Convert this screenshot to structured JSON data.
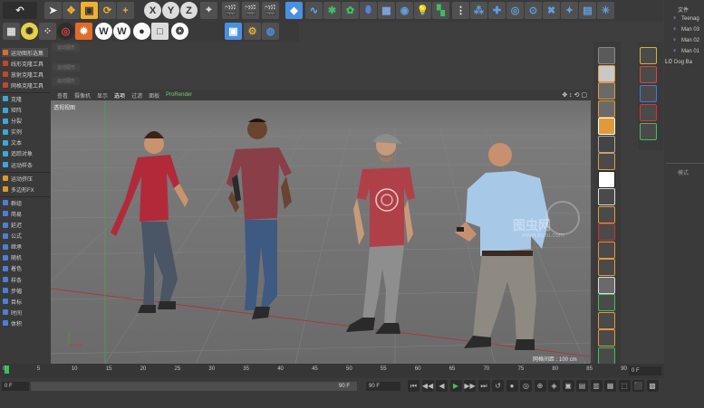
{
  "toolbar": {
    "undo_label": "↶",
    "axis_x": "X",
    "axis_y": "Y",
    "axis_z": "Z"
  },
  "left_panel": {
    "row2_letters": [
      "W",
      "W"
    ],
    "ghost_buttons": [
      "运动图形",
      "运动图形",
      "运动图形"
    ],
    "tools": [
      {
        "label": "运动图形选集",
        "color": "#e06c2b"
      },
      {
        "label": "线形克隆工具",
        "color": "#c4462e"
      },
      {
        "label": "放射克隆工具",
        "color": "#c4462e"
      },
      {
        "label": "网格克隆工具",
        "color": "#c4462e"
      },
      {
        "label": "克隆",
        "color": "#3aa8d8"
      },
      {
        "label": "矩阵",
        "color": "#3aa8d8"
      },
      {
        "label": "分裂",
        "color": "#3aa8d8"
      },
      {
        "label": "实例",
        "color": "#3aa8d8"
      },
      {
        "label": "文本",
        "color": "#3aa8d8"
      },
      {
        "label": "追踪对象",
        "color": "#3aa8d8"
      },
      {
        "label": "运动样条",
        "color": "#3aa8d8"
      },
      {
        "label": "运动挤压",
        "color": "#d99a2b"
      },
      {
        "label": "多边形FX",
        "color": "#d99a2b"
      },
      {
        "label": "群组",
        "color": "#4a7fd4"
      },
      {
        "label": "简易",
        "color": "#4a7fd4"
      },
      {
        "label": "延迟",
        "color": "#4a7fd4"
      },
      {
        "label": "公式",
        "color": "#4a7fd4"
      },
      {
        "label": "继承",
        "color": "#4a7fd4"
      },
      {
        "label": "随机",
        "color": "#4a7fd4"
      },
      {
        "label": "着色",
        "color": "#4a7fd4"
      },
      {
        "label": "样条",
        "color": "#4a7fd4"
      },
      {
        "label": "步幅",
        "color": "#4a7fd4"
      },
      {
        "label": "目标",
        "color": "#4a7fd4"
      },
      {
        "label": "时间",
        "color": "#4a7fd4"
      },
      {
        "label": "体积",
        "color": "#4a7fd4"
      }
    ]
  },
  "viewport": {
    "menu": [
      "查看",
      "摄像机",
      "显示",
      "选项",
      "过滤",
      "面板"
    ],
    "prorender": "ProRender",
    "label": "透视视图",
    "grid_info": "网格间距 : 100 cm",
    "watermark_brand": "图虫网",
    "watermark_url": "www.ikutu.com"
  },
  "timeline": {
    "ticks": [
      "0",
      "5",
      "10",
      "15",
      "20",
      "25",
      "30",
      "35",
      "40",
      "45",
      "50",
      "55",
      "60",
      "65",
      "70",
      "75",
      "80",
      "85",
      "90"
    ],
    "frame_end_label": "0 F",
    "current_frame": "0 F",
    "start_field": "0 F",
    "end_field": "90 F",
    "max_field": "90 F"
  },
  "object_manager": {
    "header": "文件",
    "items": [
      "Teenag",
      "Man 03",
      "Man 02",
      "Man 01",
      "Dog Ba"
    ],
    "attr_header": "模式"
  }
}
